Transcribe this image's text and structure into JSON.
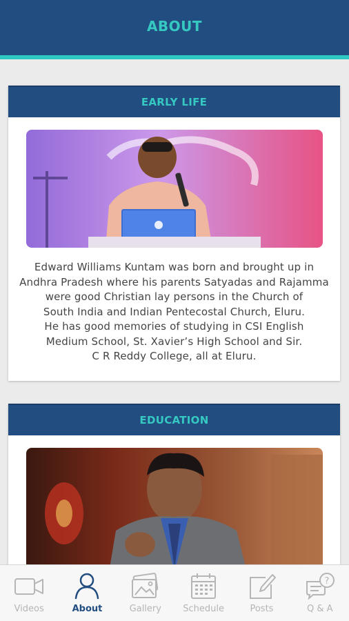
{
  "header": {
    "title": "ABOUT"
  },
  "sections": [
    {
      "title": "EARLY LIFE",
      "text": "Edward Williams Kuntam was born and brought up in\nAndhra Pradesh where his parents Satyadas and Rajamma\nwere good Christian lay persons in the Church of\nSouth India and Indian Pentecostal Church, Eluru.\nHe has good memories of studying in CSI English\nMedium School, St. Xavier’s High School and Sir.\nC R Reddy College, all at Eluru."
    },
    {
      "title": "EDUCATION"
    }
  ],
  "tabs": [
    {
      "label": "Videos",
      "icon": "video-camera-icon",
      "active": false
    },
    {
      "label": "About",
      "icon": "person-icon",
      "active": true
    },
    {
      "label": "Gallery",
      "icon": "gallery-icon",
      "active": false
    },
    {
      "label": "Schedule",
      "icon": "calendar-icon",
      "active": false
    },
    {
      "label": "Posts",
      "icon": "edit-icon",
      "active": false
    },
    {
      "label": "Q & A",
      "icon": "question-chat-icon",
      "active": false
    }
  ],
  "colors": {
    "header_bg": "#224d80",
    "accent": "#35c9c2",
    "tab_active": "#224d80",
    "tab_inactive": "#b5b5b5"
  }
}
